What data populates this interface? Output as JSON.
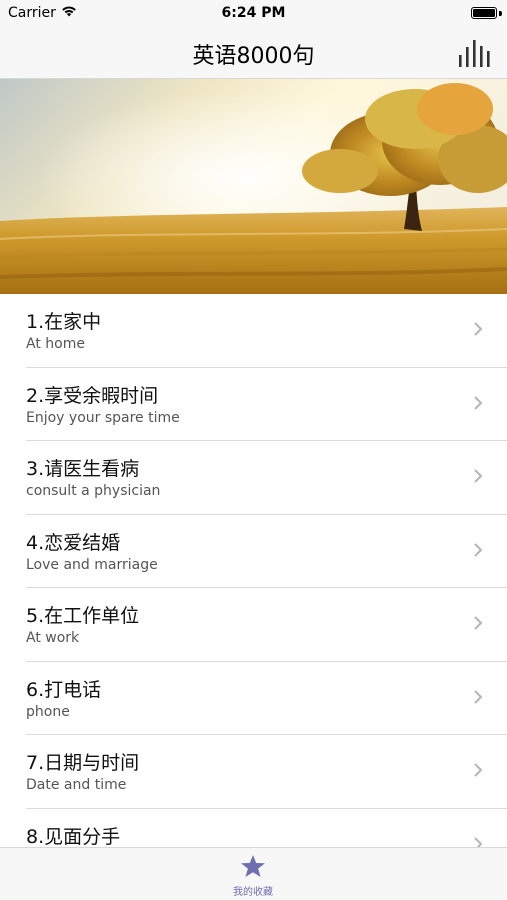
{
  "status_bar": {
    "carrier": "Carrier",
    "time": "6:24 PM"
  },
  "nav": {
    "title": "英语8000句",
    "right_icon": "bar-chart-icon"
  },
  "banner": {
    "description_icon": "tree-field-image"
  },
  "list": {
    "items": [
      {
        "title": "1.在家中",
        "subtitle": "At home"
      },
      {
        "title": "2.享受余暇时间",
        "subtitle": "Enjoy your spare time"
      },
      {
        "title": "3.请医生看病",
        "subtitle": "consult a physician"
      },
      {
        "title": "4.恋爱结婚",
        "subtitle": "Love and marriage"
      },
      {
        "title": "5.在工作单位",
        "subtitle": "At work"
      },
      {
        "title": "6.打电话",
        "subtitle": "phone"
      },
      {
        "title": "7.日期与时间",
        "subtitle": "Date and time"
      },
      {
        "title": "8.见面分手",
        "subtitle": ""
      }
    ]
  },
  "tab_bar": {
    "items": [
      {
        "label": "我的收藏",
        "icon": "star-icon",
        "color": "#6f70b0"
      }
    ]
  },
  "colors": {
    "bar_background": "#f7f7f7",
    "separator": "#dadada",
    "tab_accent": "#6f70b0"
  }
}
